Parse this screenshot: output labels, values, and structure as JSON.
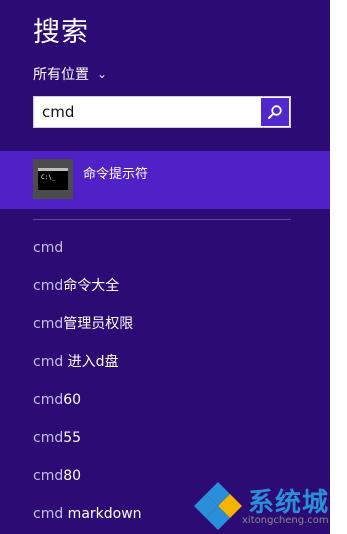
{
  "header": {
    "title": "搜索",
    "scope_label": "所有位置"
  },
  "search": {
    "value": "cmd",
    "placeholder": ""
  },
  "top_result": {
    "label": "命令提示符",
    "icon": "cmd-icon",
    "tile_text": "C:\\_"
  },
  "suggestions": [
    {
      "query": "cmd",
      "rest": ""
    },
    {
      "query": "cmd",
      "rest": "命令大全"
    },
    {
      "query": "cmd",
      "rest": "管理员权限"
    },
    {
      "query": "cmd",
      "rest": " 进入d盘"
    },
    {
      "query": "cmd",
      "rest": "60"
    },
    {
      "query": "cmd",
      "rest": "55"
    },
    {
      "query": "cmd",
      "rest": "80"
    },
    {
      "query": "cmd",
      "rest": " markdown"
    }
  ],
  "watermark": {
    "name": "系统城",
    "domain": "xitongcheng.com"
  },
  "colors": {
    "panel": "#2d0b74",
    "highlight": "#5121c8",
    "search_button": "#5128c9",
    "watermark_blue": "#2a8fd8"
  }
}
